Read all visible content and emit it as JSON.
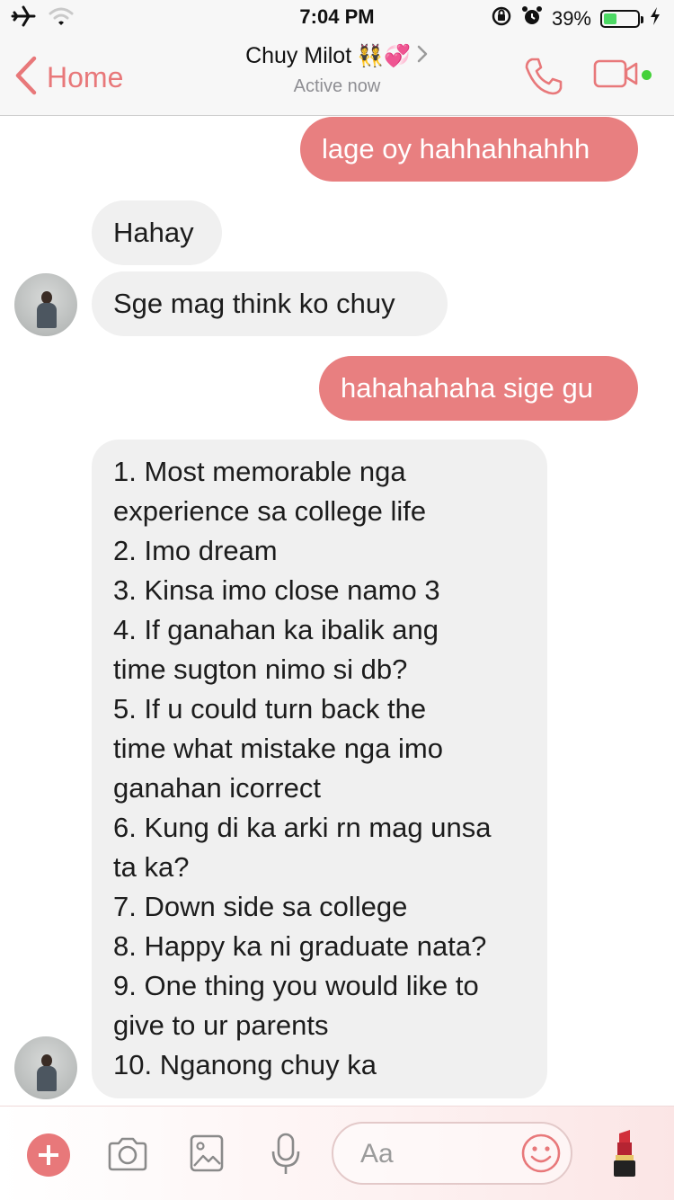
{
  "status_bar": {
    "time": "7:04 PM",
    "battery": "39%",
    "battery_level": 0.39,
    "icons": [
      "airplane-icon",
      "wifi-icon",
      "orientation-lock-icon",
      "alarm-icon",
      "battery-icon",
      "charging-icon"
    ]
  },
  "nav": {
    "back_label": "Home",
    "title": "Chuy Milot",
    "title_emoji": "👯💞",
    "subtitle": "Active now",
    "icons": [
      "chevron-left-icon",
      "chevron-right-icon",
      "phone-icon",
      "video-icon"
    ],
    "active_color": "#44d13a"
  },
  "theme": {
    "accent": "#e8787a",
    "outgoing_bubble": "#e87f80",
    "incoming_bubble": "#f0f0f0"
  },
  "messages": [
    {
      "direction": "outgoing",
      "text": "lage oy hahhahhahhh"
    },
    {
      "direction": "incoming",
      "text": "Hahay"
    },
    {
      "direction": "incoming",
      "text": "Sge mag think ko chuy"
    },
    {
      "direction": "outgoing",
      "text": "hahahahaha sige gu"
    },
    {
      "direction": "incoming",
      "lines": [
        "1. Most memorable nga",
        "experience sa college life",
        "2. Imo dream",
        "3. Kinsa imo close namo 3",
        "4. If ganahan ka ibalik ang",
        "time sugton nimo si db?",
        "5. If u could turn back the",
        "time what mistake nga imo",
        "ganahan icorrect",
        "6. Kung di ka arki rn mag unsa",
        "ta ka?",
        "7. Down side sa college",
        "8. Happy ka ni graduate nata?",
        "9. One thing you would like to",
        "give to ur parents",
        "10. Nganong chuy ka"
      ]
    }
  ],
  "composer": {
    "placeholder": "Aa",
    "icons": [
      "plus-icon",
      "camera-icon",
      "image-icon",
      "microphone-icon",
      "emoji-icon",
      "lipstick-icon"
    ]
  }
}
